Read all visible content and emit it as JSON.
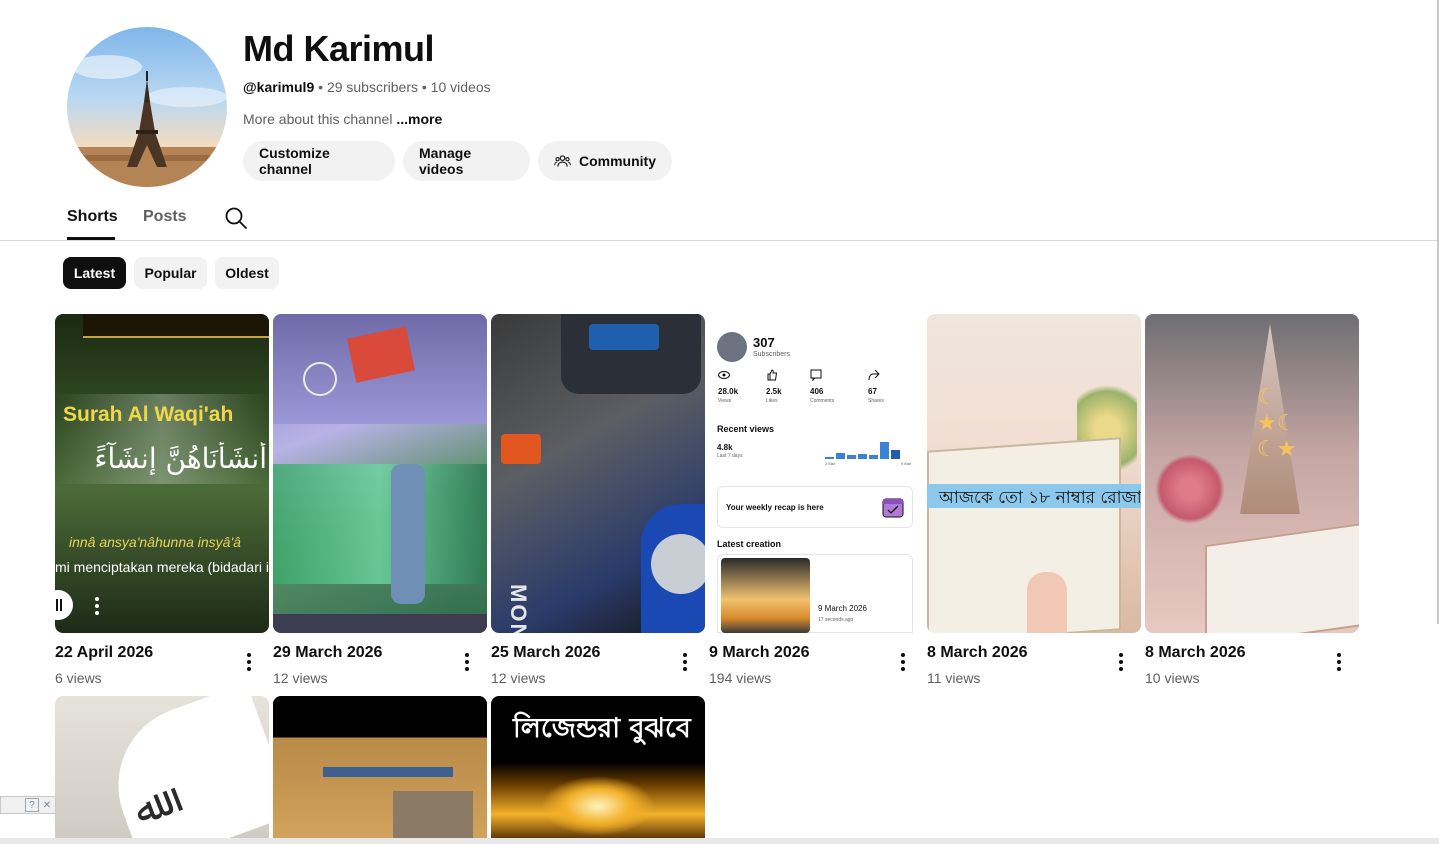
{
  "channel": {
    "name": "Md Karimul",
    "handle": "@karimul9",
    "subscribers": "29 subscribers",
    "videos": "10 videos",
    "separator": "•",
    "about": "More about this channel",
    "more": "...more"
  },
  "buttons": {
    "customize": "Customize channel",
    "manage": "Manage videos",
    "community": "Community"
  },
  "tabs": [
    {
      "label": "Shorts",
      "selected": true
    },
    {
      "label": "Posts",
      "selected": false
    }
  ],
  "chips": [
    {
      "label": "Latest",
      "selected": true
    },
    {
      "label": "Popular",
      "selected": false
    },
    {
      "label": "Oldest",
      "selected": false
    }
  ],
  "shorts": [
    {
      "date": "22 April 2026",
      "views": "6 views"
    },
    {
      "date": "29 March 2026",
      "views": "12 views"
    },
    {
      "date": "25 March 2026",
      "views": "12 views"
    },
    {
      "date": "9 March 2026",
      "views": "194 views"
    },
    {
      "date": "8 March 2026",
      "views": "11 views"
    },
    {
      "date": "8 March 2026",
      "views": "10 views"
    }
  ],
  "thumb_text": {
    "surah": "Surah Al Waqi'ah",
    "arabic": "أَنشَأْنَاهُنَّ إِنشَآءً",
    "translit": "innâ ansya'nâhunna insyâ'â",
    "indo": "mi menciptakan mereka (bidadari it",
    "monster": "MONSTER",
    "bangla_roza": "আজকে তো ১৮ নাম্বার রোজা",
    "bangla_legend": "লিজেন্ডরা বুঝবে"
  },
  "studio_card": {
    "subscribers": "307",
    "subscribers_label": "Subscribers",
    "stats": [
      {
        "value": "28.0k",
        "label": "Views"
      },
      {
        "value": "2.5k",
        "label": "Likes"
      },
      {
        "value": "406",
        "label": "Comments"
      },
      {
        "value": "67",
        "label": "Shares"
      }
    ],
    "recent_title": "Recent views",
    "recent_value": "4.8k",
    "recent_sub": "Last 7 days",
    "axis_start": "2 Mar",
    "axis_end": "9 Mar",
    "recap": "Your weekly recap is here",
    "latest_title": "Latest creation",
    "latest_date": "9 March 2026",
    "latest_ago": "17 seconds ago"
  },
  "colors": {
    "text_primary": "#0f0f0f",
    "text_secondary": "#606060",
    "chip_bg": "#f2f2f2",
    "surah_yellow": "#f1d84b",
    "bangla_banner": "#8cc8ec"
  }
}
